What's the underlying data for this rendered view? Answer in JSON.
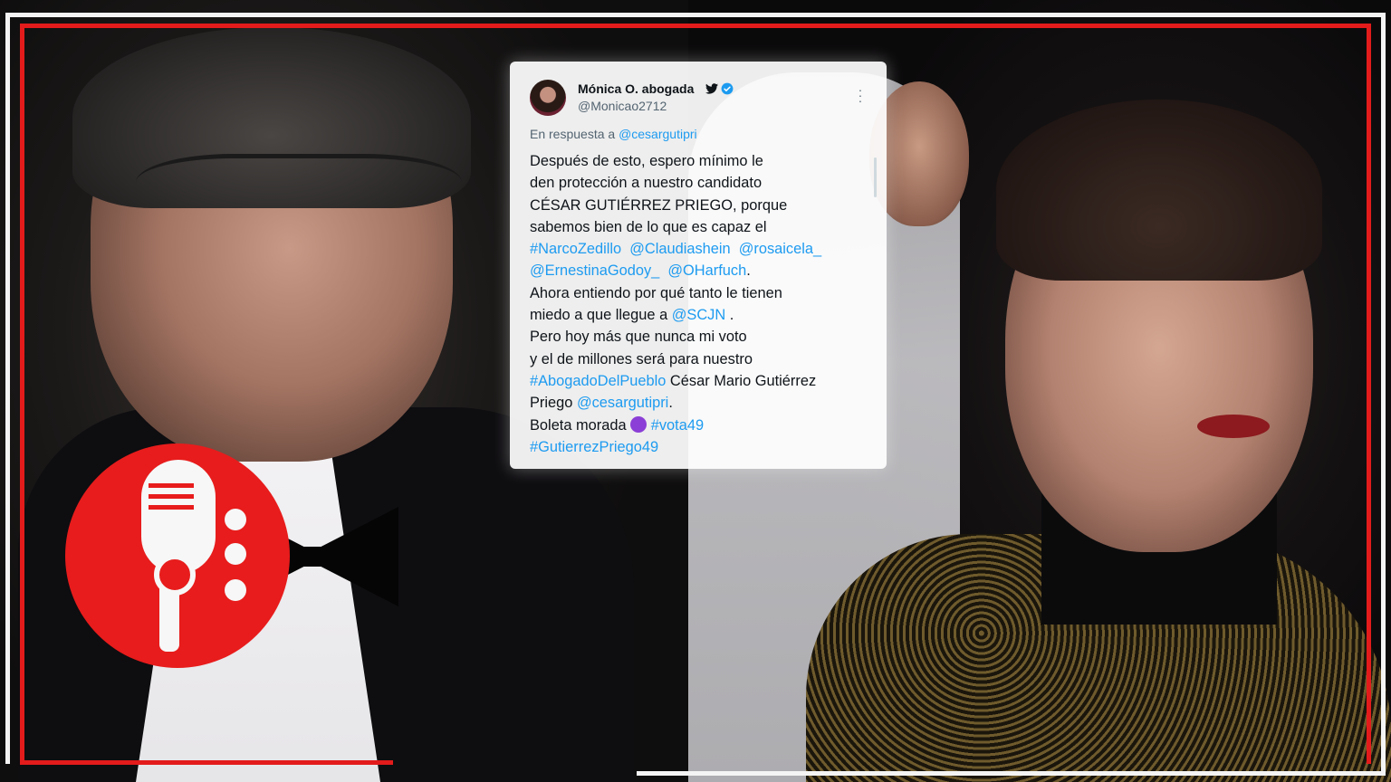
{
  "tweet": {
    "author_name": "Mónica O. abogada",
    "handle": "@Monicao2712",
    "reply_prefix": "En respuesta a",
    "reply_to": "@cesargutipri",
    "body": {
      "l1": "Después de esto, espero mínimo le",
      "l2": "den protección a nuestro candidato",
      "l3": "CÉSAR GUTIÉRREZ PRIEGO, porque",
      "l4": "sabemos bien de lo que es capaz el",
      "tag_narcozedillo": "#NarcoZedillo",
      "mention_claudia": "@Claudiashein",
      "mention_rosaicela": "@rosaicela_",
      "mention_ernestina": "@ErnestinaGodoy_",
      "mention_oharfuch": "@OHarfuch",
      "period1": ".",
      "l7": "Ahora entiendo por qué tanto le tienen",
      "l8_text": "miedo a que llegue a",
      "mention_scjn": "@SCJN",
      "l8_end": " .",
      "l9": "Pero hoy más que nunca mi voto",
      "l10": "y el de millones será para nuestro",
      "tag_abogado": "#AbogadoDelPueblo",
      "l11_text": " César Mario Gutiérrez",
      "l12_text": "Priego",
      "mention_cesar": "@cesargutipri",
      "period2": ".",
      "l13_text": "Boleta morada",
      "tag_vota49": "#vota49",
      "tag_gutierrez": "#GutierrezPriego49"
    },
    "colors": {
      "link": "#1d9bf0",
      "verified": "#1d9bf0",
      "emoji_purple": "#8b3fd6"
    },
    "icons": {
      "bird": "twitter-bird-icon",
      "verified": "verified-badge-icon",
      "more": "more-options-icon",
      "emoji": "purple-circle-emoji"
    }
  },
  "logo": {
    "icon": "microphone-icon",
    "color": "#e81c1c"
  },
  "frame": {
    "accent": "#e31b1b",
    "secondary": "#f4f4f4"
  }
}
